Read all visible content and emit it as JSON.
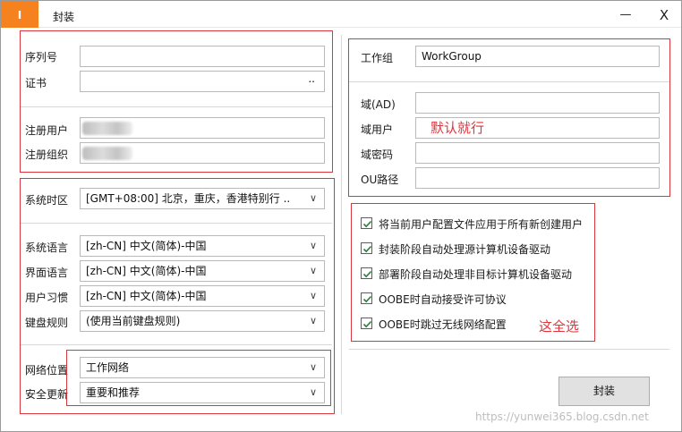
{
  "app": {
    "icon_letter": "I",
    "title": "封装",
    "minimize_glyph": "—",
    "close_glyph": "X"
  },
  "identity": {
    "serial_label": "序列号",
    "serial_value": "",
    "cert_label": "证书",
    "cert_value": "",
    "cert_dots": "..",
    "reg_user_label": "注册用户",
    "reg_org_label": "注册组织"
  },
  "locale": {
    "timezone_label": "系统时区",
    "timezone_value": "[GMT+08:00] 北京，重庆，香港特别行 ..",
    "sys_lang_label": "系统语言",
    "sys_lang_value": "[zh-CN] 中文(简体)-中国",
    "ui_lang_label": "界面语言",
    "ui_lang_value": "[zh-CN] 中文(简体)-中国",
    "user_locale_label": "用户习惯",
    "user_locale_value": "[zh-CN] 中文(简体)-中国",
    "keyboard_label": "键盘规则",
    "keyboard_value": "(使用当前键盘规则)"
  },
  "network": {
    "location_label": "网络位置",
    "location_value": "工作网络",
    "update_label": "安全更新",
    "update_value": "重要和推荐"
  },
  "domain": {
    "workgroup_label": "工作组",
    "workgroup_value": "WorkGroup",
    "ad_label": "域(AD)",
    "ad_value": "",
    "user_label": "域用户",
    "user_value": "",
    "password_label": "域密码",
    "password_value": "",
    "ou_label": "OU路径",
    "ou_value": ""
  },
  "options": [
    {
      "label": "将当前用户配置文件应用于所有新创建用户",
      "checked": true
    },
    {
      "label": "封装阶段自动处理源计算机设备驱动",
      "checked": true
    },
    {
      "label": "部署阶段自动处理非目标计算机设备驱动",
      "checked": true
    },
    {
      "label": "OOBE时自动接受许可协议",
      "checked": true
    },
    {
      "label": "OOBE时跳过无线网络配置",
      "checked": true
    }
  ],
  "annotations": {
    "default_ok": "默认就行",
    "select_all": "这全选"
  },
  "actions": {
    "seal_button": "封装"
  },
  "chevron_glyph": "∨",
  "watermark": "https://yunwei365.blog.csdn.net",
  "colors": {
    "annotation_red": "#e0353b",
    "title_accent": "#f5821f",
    "check_green": "#2f7d3a"
  }
}
